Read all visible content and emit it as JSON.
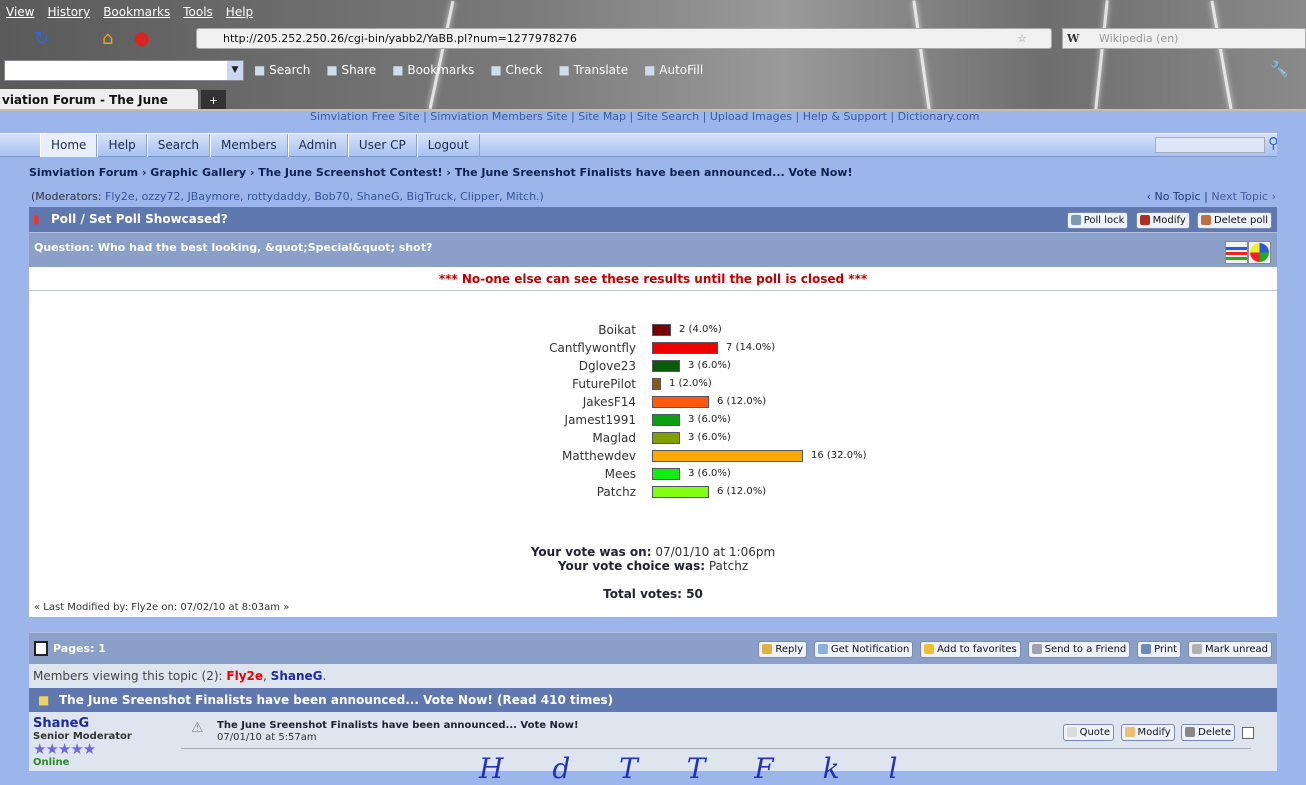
{
  "browser": {
    "menu": [
      "View",
      "History",
      "Bookmarks",
      "Tools",
      "Help"
    ],
    "url": "http://205.252.250.26/cgi-bin/yabb2/YaBB.pl?num=1277978276",
    "search_engine_placeholder": "Wikipedia (en)",
    "toolbar": [
      "Search",
      "Share",
      "Bookmarks",
      "Check",
      "Translate",
      "AutoFill"
    ],
    "tab_title": "viation Forum - The June Sreens...",
    "new_tab": "+"
  },
  "site_links": "Simviation Free Site | Simviation Members Site | Site Map | Site Search | Upload Images | Help & Support | Dictionary.com",
  "nav": {
    "tabs": [
      "Home",
      "Help",
      "Search",
      "Members",
      "Admin",
      "User CP",
      "Logout"
    ]
  },
  "breadcrumb": "Simviation Forum › Graphic Gallery › The June Screenshot Contest! › The June Sreenshot Finalists have been announced... Vote Now!",
  "moderators": {
    "label": "(Moderators: ",
    "names": "Fly2e, ozzy72, JBaymore, rottydaddy, Bob70, ShaneG, BigTruck, Clipper, Mitch.)"
  },
  "topic_nav": {
    "prev": "‹ No Topic",
    "sep": " | ",
    "next": "Next Topic ›"
  },
  "poll": {
    "title": "Poll / Set Poll Showcased?",
    "buttons": [
      "Poll lock",
      "Modify",
      "Delete poll"
    ],
    "question": "Question: Who had the best looking, &quot;Special&quot; shot?",
    "warning": "*** No-one else can see these results until the poll is closed ***",
    "vote_on_label": "Your vote was on:",
    "vote_on_value": " 07/01/10 at 1:06pm",
    "vote_choice_label": "Your vote choice was:",
    "vote_choice_value": " Patchz",
    "total_votes": "Total votes: 50",
    "last_modified": "« Last Modified by: Fly2e on: 07/02/10 at 8:03am »"
  },
  "chart_data": {
    "type": "bar",
    "orientation": "horizontal",
    "categories": [
      "Boikat",
      "Cantflywontfly",
      "Dglove23",
      "FuturePilot",
      "JakesF14",
      "Jamest1991",
      "Maglad",
      "Matthewdev",
      "Mees",
      "Patchz"
    ],
    "values": [
      2,
      7,
      3,
      1,
      6,
      3,
      3,
      16,
      3,
      6
    ],
    "labels": [
      "2 (4.0%)",
      "7 (14.0%)",
      "3 (6.0%)",
      "1 (2.0%)",
      "6 (12.0%)",
      "3 (6.0%)",
      "3 (6.0%)",
      "16 (32.0%)",
      "3 (6.0%)",
      "6 (12.0%)"
    ],
    "colors": [
      "#7a0000",
      "#ee0000",
      "#0a5a0a",
      "#8a5a10",
      "#ff5a10",
      "#0aa010",
      "#80a000",
      "#ffa800",
      "#10ee10",
      "#80ff10"
    ]
  },
  "pages_bar": {
    "label": "Pages: 1",
    "buttons": [
      "Reply",
      "Get Notification",
      "Add to favorites",
      "Send to a Friend",
      "Print",
      "Mark unread"
    ]
  },
  "viewing": {
    "text": "Members viewing this topic (2): ",
    "user1": "Fly2e",
    "sep": ", ",
    "user2": "ShaneG",
    "end": "."
  },
  "topic_header": "The June Sreenshot Finalists have been announced... Vote Now! (Read 410 times)",
  "post": {
    "author": "ShaneG",
    "rank": "Senior Moderator",
    "stars": "★★★★★",
    "status": "Online",
    "title": "The June Sreenshot Finalists have been announced... Vote Now!",
    "date": "07/01/10 at 5:57am",
    "buttons": [
      "Quote",
      "Modify",
      "Delete"
    ],
    "body_partial": "H  d  T  T  F  k  l"
  }
}
